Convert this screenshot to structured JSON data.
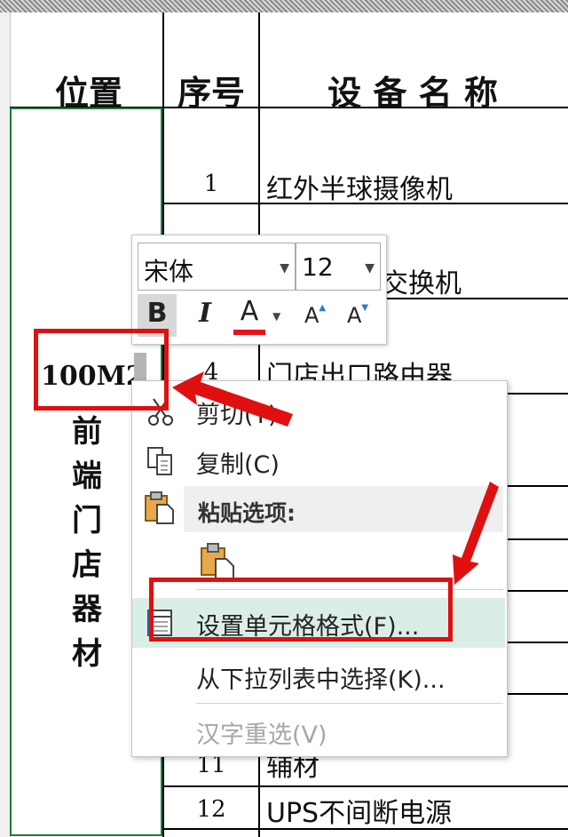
{
  "sheet": {
    "headers": {
      "position": "位置",
      "seq": "序号",
      "device": "设 备 名 称"
    },
    "rows": [
      {
        "seq": "1",
        "name": "红外半球摄像机"
      },
      {
        "seq": "",
        "name": "交换机"
      },
      {
        "seq": "4",
        "name": "门店出口路由器"
      },
      {
        "seq": "11",
        "name": "辅材"
      },
      {
        "seq": "12",
        "name": "UPS不间断电源"
      }
    ],
    "active_cell_value": "100M2",
    "merged_cell_chars": [
      "前",
      "端",
      "门",
      "店",
      "器",
      "材"
    ]
  },
  "mini_toolbar": {
    "font_name": "宋体",
    "font_size": "12",
    "bold": "B",
    "italic": "I",
    "font_color_letter": "A",
    "font_color": "#e8101a",
    "grow_font": "A",
    "shrink_font": "A"
  },
  "context_menu": {
    "cut": "剪切(T)",
    "copy": "复制(C)",
    "paste_options_header": "粘贴选项:",
    "format_cells": "设置单元格格式(F)...",
    "pick_from_list": "从下拉列表中选择(K)...",
    "reconvert": "汉字重选(V)"
  },
  "colors": {
    "highlight_box": "#e01010",
    "selection_border": "#1d7a3c",
    "menu_hover": "#dbeee5"
  }
}
